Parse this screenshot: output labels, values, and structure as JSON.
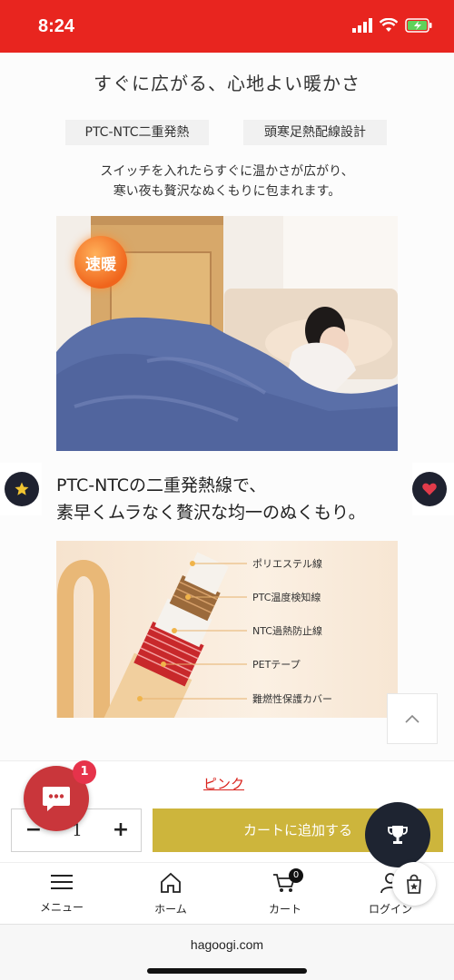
{
  "status": {
    "time": "8:24"
  },
  "content": {
    "headline": "すぐに広がる、心地よい暖かさ",
    "tags": [
      "PTC-NTC二重発熱",
      "頭寒足熱配線設計"
    ],
    "desc_line1": "スイッチを入れたらすぐに温かさが広がり、",
    "desc_line2": "寒い夜も贅沢なぬくもりに包まれます。",
    "badge": "速暖",
    "sub_headline_line1": "PTC-NTCの二重発熱線で、",
    "sub_headline_line2": "素早くムラなく贅沢な均一のぬくもり。",
    "cable_layers": [
      "ポリエステル線",
      "PTC温度検知線",
      "NTC過熱防止線",
      "PETテープ",
      "難燃性保護カバー"
    ]
  },
  "product": {
    "variant": "ピンク",
    "qty_minus": "−",
    "quantity": "1",
    "qty_plus": "+",
    "add_to_cart": "カートに追加する"
  },
  "chat": {
    "unread": "1"
  },
  "nav": {
    "menu": "メニュー",
    "home": "ホーム",
    "cart": "カート",
    "cart_count": "0",
    "login": "ログイン"
  },
  "browser": {
    "url": "hagoogi.com"
  },
  "colors": {
    "status_bar": "#e8251f",
    "cart_button": "#cdb53c",
    "dark_button": "#1e2431",
    "chat": "#c9363b"
  }
}
